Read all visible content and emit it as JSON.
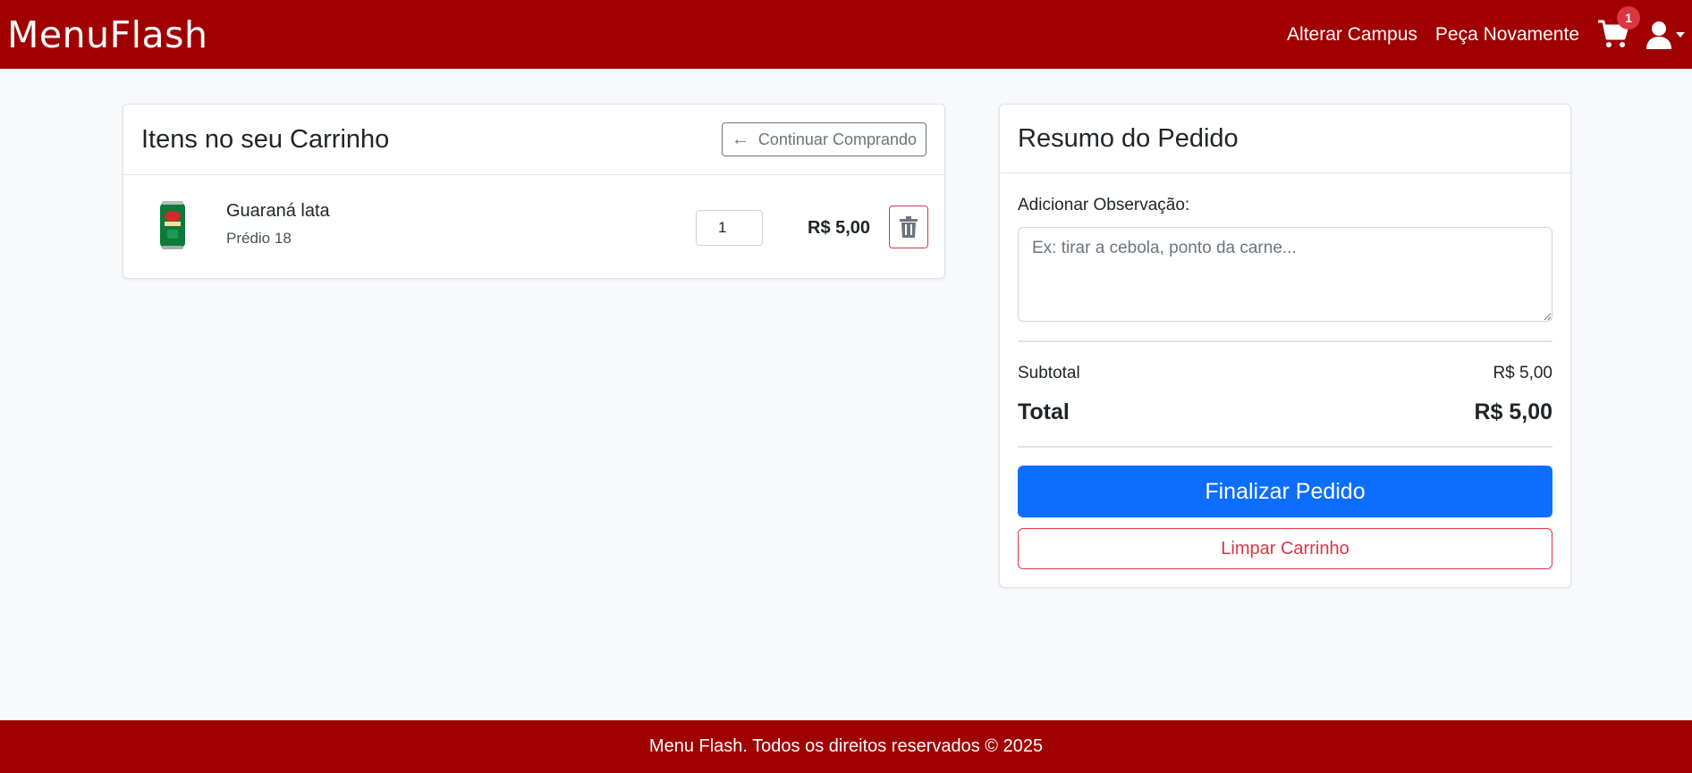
{
  "navbar": {
    "brand": "MenuFlash",
    "links": [
      "Alterar Campus",
      "Peça Novamente"
    ],
    "cart_count": "1",
    "bg_color": "#a00000"
  },
  "cart": {
    "title": "Itens no seu Carrinho",
    "continue_label": "Continuar Comprando",
    "items": [
      {
        "name": "Guaraná lata",
        "location": "Prédio 18",
        "quantity": "1",
        "price": "R$ 5,00",
        "icons": {
          "image": "soda-can-image",
          "delete": "trash-icon"
        }
      }
    ]
  },
  "summary": {
    "title": "Resumo do Pedido",
    "obs_label": "Adicionar Observação:",
    "obs_placeholder": "Ex: tirar a cebola, ponto da carne...",
    "subtotal_label": "Subtotal",
    "subtotal_value": "R$ 5,00",
    "total_label": "Total",
    "total_value": "R$ 5,00",
    "finalize_label": "Finalizar Pedido",
    "clear_label": "Limpar Carrinho"
  },
  "footer": {
    "text": "Menu Flash. Todos os direitos reservados © 2025"
  }
}
